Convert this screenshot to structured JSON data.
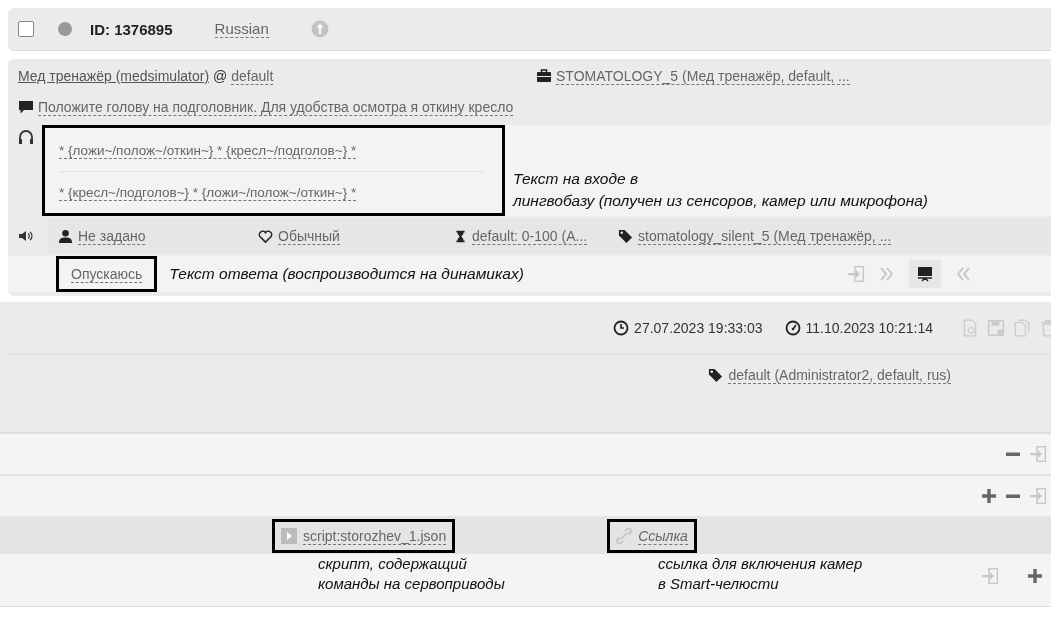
{
  "record": {
    "checked": false,
    "id": "ID: 1376895",
    "language": "Russian"
  },
  "bot_line": {
    "bot": "Мед тренажёр (medsimulator)",
    "at": "@",
    "owner": "default",
    "project": "STOMATOLOGY_5 (Мед тренажёр, default, ..."
  },
  "phrase": "Положите голову на подголовник. Для удобства осмотра я откину кресло",
  "patterns": [
    "* {ложи~/полож~/откин~} * {кресл~/подголов~} *",
    "* {кресл~/подголов~} * {ложи~/полож~/откин~} *"
  ],
  "input_note": [
    "Текст на входе в",
    "лингвобазу (получен из сенсоров, камер или микрофона)"
  ],
  "attributes": [
    {
      "kind": "person",
      "text": "Не задано"
    },
    {
      "kind": "heart",
      "text": "Обычный"
    },
    {
      "kind": "hourglass",
      "text": "default: 0-100 (A..."
    },
    {
      "kind": "tag",
      "text": "stomatology_silent_5 (Мед тренажёр, ..."
    }
  ],
  "answer": "Опускаюсь",
  "answer_note": "Текст ответа (воспроизводится на динамиках)",
  "created": "27.07.2023 19:33:03",
  "modified": "11.10.2023 10:21:14",
  "tag": "default (Administrator2, default, rus)",
  "script": "script:storozhev_1.json",
  "link": "Ссылка",
  "script_note": [
    "скрипт, содержащий",
    "команды на сервоприводы"
  ],
  "link_note": [
    "ссылка для включения камер",
    "в Smart-челюсти"
  ]
}
